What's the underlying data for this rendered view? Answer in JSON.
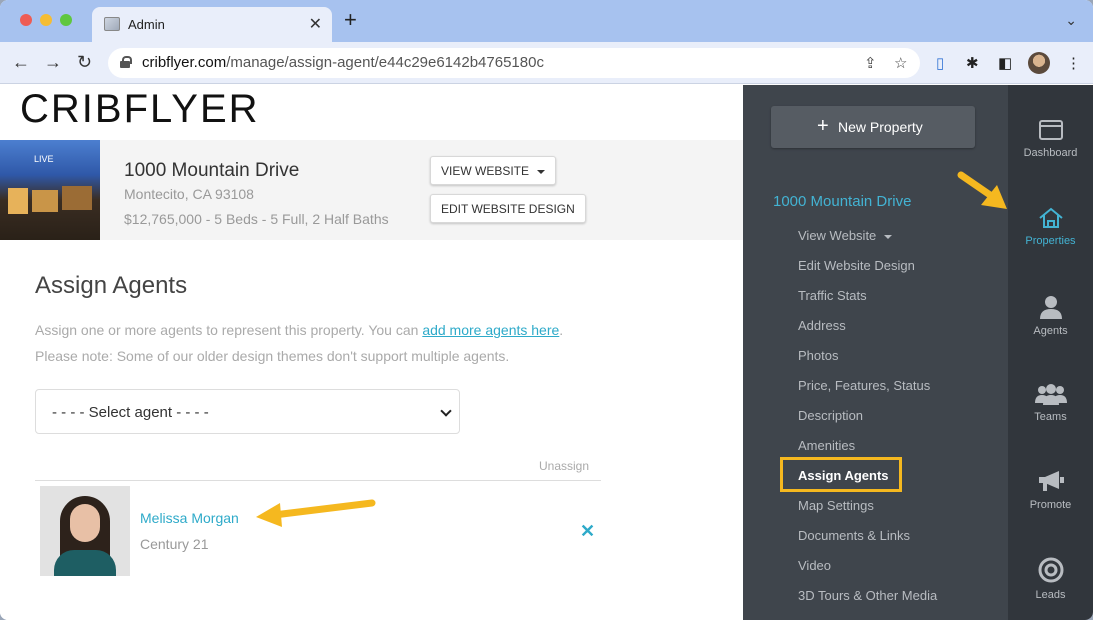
{
  "browser": {
    "tab_title": "Admin",
    "url_host": "cribflyer.com",
    "url_path": "/manage/assign-agent/e44c29e6142b4765180c"
  },
  "page": {
    "logo": "CRIBFLYER",
    "property": {
      "thumb_badge": "LIVE",
      "title": "1000 Mountain Drive",
      "city": "Montecito, CA 93108",
      "details": "$12,765,000 - 5 Beds - 5 Full, 2 Half Baths",
      "view_website_label": "VIEW WEBSITE",
      "edit_design_label": "EDIT WEBSITE DESIGN"
    },
    "section_title": "Assign Agents",
    "help_text_before": "Assign one or more agents to represent this property. You can ",
    "help_link": "add more agents here",
    "help_text_after": ".",
    "help_note": "Please note: Some of our older design themes don't support multiple agents.",
    "select_placeholder": "- - - - Select agent - - - -",
    "unassign_header": "Unassign",
    "agents": [
      {
        "name": "Melissa Morgan",
        "company": "Century 21"
      }
    ]
  },
  "sidebar": {
    "new_property_label": "New Property",
    "property_title": "1000 Mountain Drive",
    "items": [
      {
        "label": "View Website"
      },
      {
        "label": "Edit Website Design"
      },
      {
        "label": "Traffic Stats"
      },
      {
        "label": "Address"
      },
      {
        "label": "Photos"
      },
      {
        "label": "Price, Features, Status"
      },
      {
        "label": "Description"
      },
      {
        "label": "Amenities"
      },
      {
        "label": "Assign Agents"
      },
      {
        "label": "Map Settings"
      },
      {
        "label": "Documents & Links"
      },
      {
        "label": "Video"
      },
      {
        "label": "3D Tours & Other Media"
      }
    ],
    "active_item": "Assign Agents"
  },
  "iconbar": {
    "items": [
      {
        "label": "Dashboard",
        "icon": "dashboard-icon"
      },
      {
        "label": "Properties",
        "icon": "house-icon"
      },
      {
        "label": "Agents",
        "icon": "person-icon"
      },
      {
        "label": "Teams",
        "icon": "group-icon"
      },
      {
        "label": "Promote",
        "icon": "megaphone-icon"
      },
      {
        "label": "Leads",
        "icon": "target-icon"
      }
    ],
    "active": "Properties"
  },
  "colors": {
    "accent": "#43b3d3",
    "link": "#2eaac9",
    "highlight": "#f5b81f",
    "sidebar_bg": "#3f454c",
    "iconbar_bg": "#31363c"
  }
}
